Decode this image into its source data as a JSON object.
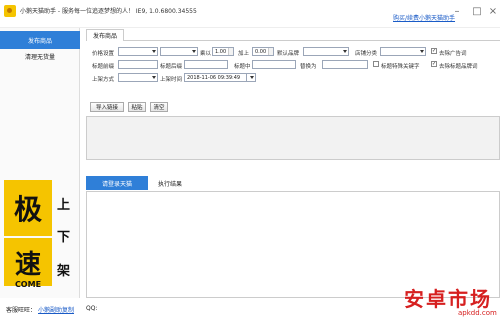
{
  "titlebar": {
    "title": "小鹅天猫助手 - 服务每一位追逐梦想的人！ IE9, 1.0.6800.34555",
    "link": "购买/续费小鹅天猫助手"
  },
  "sidebar": {
    "items": [
      {
        "label": "发布商品"
      },
      {
        "label": "清理无货量"
      }
    ]
  },
  "promo": {
    "char1": "极",
    "char2": "速",
    "word": "COME",
    "side1": "上",
    "side2": "下",
    "side3": "架"
  },
  "tab": {
    "label": "发布商品"
  },
  "form": {
    "price_label": "价格设置",
    "multiply_label": "乘以",
    "multiply_value": "1.00",
    "add_label": "加上",
    "add_value": "0.00",
    "brand_label": "默认品牌",
    "shop_category_label": "店铺分类",
    "remove_ads_label": "去除广告词",
    "title_prefix_label": "标题前缀",
    "title_suffix_label": "标题后缀",
    "title_middle_label": "标题中",
    "replace_label": "替换为",
    "title_special_label": "标题特殊关键字",
    "remove_brand_label": "去除标题品牌词",
    "listing_method_label": "上架方式",
    "listing_time_label": "上架时间",
    "listing_time_value": "2018-11-06  09:39:49"
  },
  "actions": {
    "import": "导入链接",
    "paste": "粘贴",
    "clear": "清空"
  },
  "subtabs": [
    {
      "label": "请登录天猫"
    },
    {
      "label": "执行结果"
    }
  ],
  "status": {
    "wangwang_label": "客服旺旺：",
    "wangwang_link": "小鹅副助复制",
    "qq_label": "QQ:"
  },
  "watermark": {
    "text": "安卓市场",
    "domain": "apkdd.com"
  },
  "colors": {
    "accent": "#2f7fd8",
    "promo_yellow": "#f5c400",
    "watermark_red": "#d62020"
  }
}
